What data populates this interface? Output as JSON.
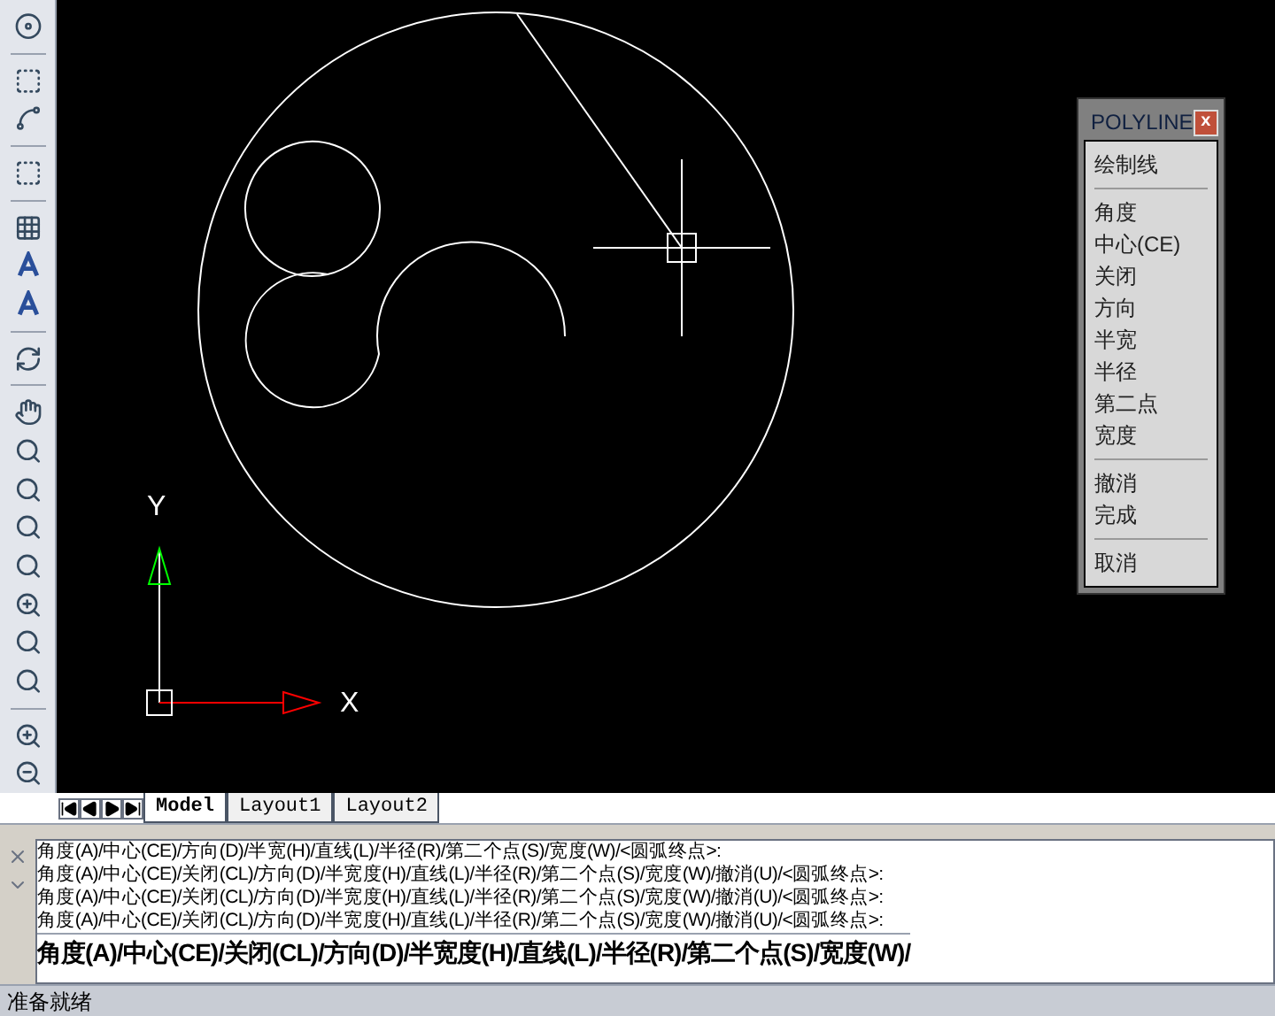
{
  "canvas": {
    "axis_y": "Y",
    "axis_x": "X"
  },
  "menu": {
    "title": "POLYLINE",
    "close": "x",
    "items": [
      {
        "kind": "item",
        "label": "绘制线"
      },
      {
        "kind": "separator"
      },
      {
        "kind": "item",
        "label": "角度"
      },
      {
        "kind": "item",
        "label": "中心(CE)"
      },
      {
        "kind": "item",
        "label": "关闭"
      },
      {
        "kind": "item",
        "label": "方向"
      },
      {
        "kind": "item",
        "label": "半宽"
      },
      {
        "kind": "item",
        "label": "半径"
      },
      {
        "kind": "item",
        "label": "第二点"
      },
      {
        "kind": "item",
        "label": "宽度"
      },
      {
        "kind": "separator"
      },
      {
        "kind": "item",
        "label": "撤消"
      },
      {
        "kind": "item",
        "label": "完成"
      },
      {
        "kind": "separator"
      },
      {
        "kind": "item",
        "label": "取消"
      }
    ]
  },
  "tabs": [
    {
      "label": "Model",
      "selected": true
    },
    {
      "label": "Layout1",
      "selected": false
    },
    {
      "label": "Layout2",
      "selected": false
    }
  ],
  "command": {
    "history": [
      "角度(A)/中心(CE)/方向(D)/半宽(H)/直线(L)/半径(R)/第二个点(S)/宽度(W)/<圆弧终点>:",
      "角度(A)/中心(CE)/关闭(CL)/方向(D)/半宽度(H)/直线(L)/半径(R)/第二个点(S)/宽度(W)/撤消(U)/<圆弧终点>:",
      "角度(A)/中心(CE)/关闭(CL)/方向(D)/半宽度(H)/直线(L)/半径(R)/第二个点(S)/宽度(W)/撤消(U)/<圆弧终点>:",
      "角度(A)/中心(CE)/关闭(CL)/方向(D)/半宽度(H)/直线(L)/半径(R)/第二个点(S)/宽度(W)/撤消(U)/<圆弧终点>:"
    ],
    "input": "角度(A)/中心(CE)/关闭(CL)/方向(D)/半宽度(H)/直线(L)/半径(R)/第二个点(S)/宽度(W)/"
  },
  "status_bar": {
    "text": "准备就绪"
  }
}
